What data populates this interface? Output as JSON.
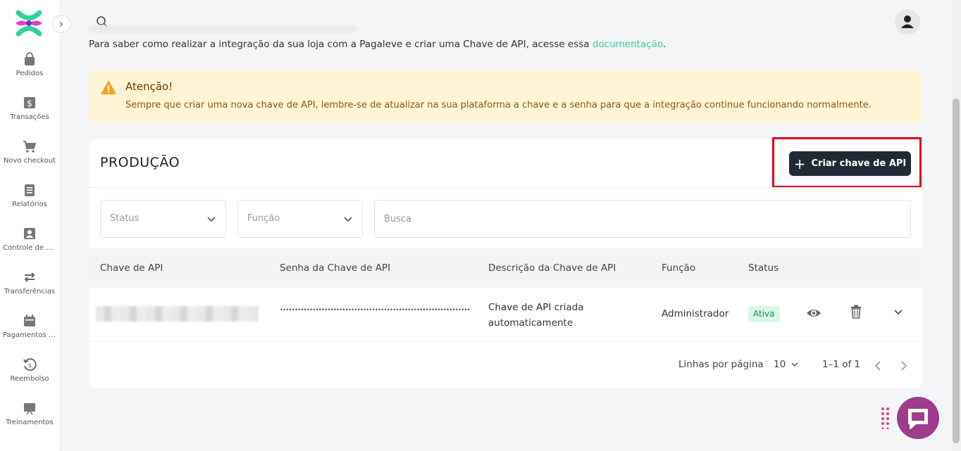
{
  "sidebar": {
    "items": [
      {
        "label": "Pedidos",
        "icon": "bag-icon"
      },
      {
        "label": "Transações",
        "icon": "dollar-icon"
      },
      {
        "label": "Novo checkout",
        "icon": "cart-icon"
      },
      {
        "label": "Relatórios",
        "icon": "report-icon"
      },
      {
        "label": "Controle de acesso",
        "icon": "user-icon"
      },
      {
        "label": "Transferências",
        "icon": "transfer-icon"
      },
      {
        "label": "Pagamentos agendados",
        "icon": "calendar-icon"
      },
      {
        "label": "Reembolso",
        "icon": "refund-icon"
      },
      {
        "label": "Treinamentos",
        "icon": "training-icon"
      }
    ],
    "collapse_glyph": "›"
  },
  "intro": {
    "text": "Para saber como realizar a integração da sua loja com a Pagaleve e criar uma Chave de API, acesse essa ",
    "link": "documentação",
    "suffix": "."
  },
  "alert": {
    "title": "Atenção!",
    "text": "Sempre que criar uma nova chave de API, lembre-se de atualizar na sua plataforma a chave e a senha para que a integração continue funcionando normalmente."
  },
  "card": {
    "title": "PRODUÇÃO",
    "create_button": "Criar chave de API",
    "filters": {
      "status_placeholder": "Status",
      "function_placeholder": "Função",
      "search_placeholder": "Busca"
    },
    "columns": [
      "Chave de API",
      "Senha da Chave de API",
      "Descrição da Chave de API",
      "Função",
      "Status"
    ],
    "rows": [
      {
        "key": "",
        "password": "••••••••••••••••••••••••••••••••••••••••••••••••••••••••••••••••",
        "description": "Chave de API criada automaticamente",
        "function": "Administrador",
        "status": "Ativa"
      }
    ],
    "footer": {
      "rows_per_page_label": "Linhas por página",
      "rows_per_page": "10",
      "range": "1–1 of 1"
    }
  },
  "colors": {
    "accent": "#2fd39a",
    "button": "#1f2a35",
    "alert_bg": "#fff4d6",
    "highlight": "#e0001b",
    "chat": "#9d3d8c"
  }
}
